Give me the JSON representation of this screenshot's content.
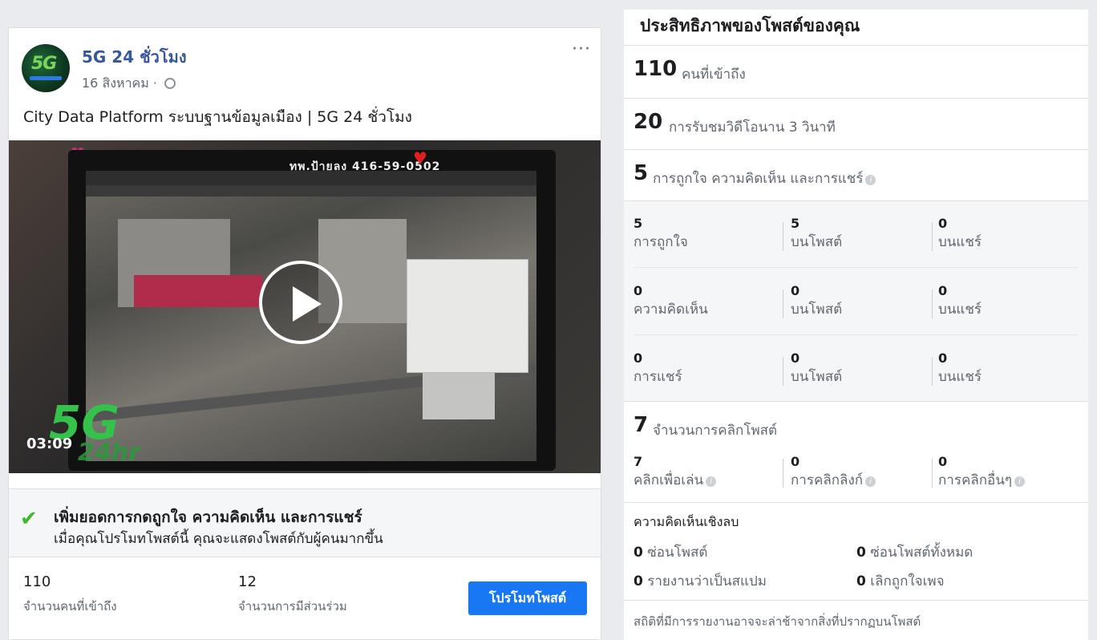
{
  "post": {
    "page_name": "5G 24 ชั่วโมง",
    "date": "16 สิงหาคม · ",
    "more_label": "···",
    "title": "City Data Platform ระบบฐานข้อมูลเมือง | 5G 24 ชั่วโมง",
    "avatar_text": "5G",
    "video": {
      "duration": "03:09",
      "logo_5g": "5G",
      "logo_24": "24hr",
      "plate_text": "ทพ.ป้ายลง 416-59-0502"
    },
    "promo": {
      "title": "เพิ่มยอดการกดถูกใจ ความคิดเห็น และการแชร์",
      "subtitle": "เมื่อคุณโปรโมทโพสต์นี้ คุณจะแสดงโพสต์กับผู้คนมากขึ้น"
    },
    "stats": [
      {
        "value": "110",
        "label": "จำนวนคนที่เข้าถึง"
      },
      {
        "value": "12",
        "label": "จำนวนการมีส่วนร่วม"
      }
    ],
    "promote_button": "โปรโมทโพสต์"
  },
  "insights": {
    "heading": "ประสิทธิภาพของโพสต์ของคุณ",
    "reach": {
      "value": "110",
      "label": "คนที่เข้าถึง"
    },
    "views": {
      "value": "20",
      "label": "การรับชมวิดีโอนาน 3 วินาที"
    },
    "reactions": {
      "value": "5",
      "label": "การถูกใจ ความคิดเห็น และการแชร์"
    },
    "breakdown": [
      [
        {
          "value": "5",
          "label": "การถูกใจ"
        },
        {
          "value": "5",
          "label": "บนโพสต์"
        },
        {
          "value": "0",
          "label": "บนแชร์"
        }
      ],
      [
        {
          "value": "0",
          "label": "ความคิดเห็น"
        },
        {
          "value": "0",
          "label": "บนโพสต์"
        },
        {
          "value": "0",
          "label": "บนแชร์"
        }
      ],
      [
        {
          "value": "0",
          "label": "การแชร์"
        },
        {
          "value": "0",
          "label": "บนโพสต์"
        },
        {
          "value": "0",
          "label": "บนแชร์"
        }
      ]
    ],
    "clicks": {
      "value": "7",
      "label": "จำนวนการคลิกโพสต์"
    },
    "click_breakdown": [
      {
        "value": "7",
        "label": "คลิกเพื่อเล่น"
      },
      {
        "value": "0",
        "label": "การคลิกลิงก์"
      },
      {
        "value": "0",
        "label": "การคลิกอื่นๆ"
      }
    ],
    "negative": {
      "title": "ความคิดเห็นเชิงลบ",
      "items": [
        {
          "value": "0",
          "label": "ซ่อนโพสต์"
        },
        {
          "value": "0",
          "label": "ซ่อนโพสต์ทั้งหมด"
        },
        {
          "value": "0",
          "label": "รายงานว่าเป็นสแปม"
        },
        {
          "value": "0",
          "label": "เลิกถูกใจเพจ"
        }
      ]
    },
    "footnote": "สถิติที่มีการรายงานอาจจะล่าช้าจากสิ่งที่ปรากฏบนโพสต์"
  },
  "colors": {
    "brand_blue": "#1877f2",
    "link_blue": "#365899",
    "check_green": "#42b72a",
    "page_bg": "#e9ebee"
  },
  "icons": [
    "globe-icon",
    "more-icon",
    "play-icon",
    "check-icon",
    "info-icon",
    "heart-icon"
  ]
}
